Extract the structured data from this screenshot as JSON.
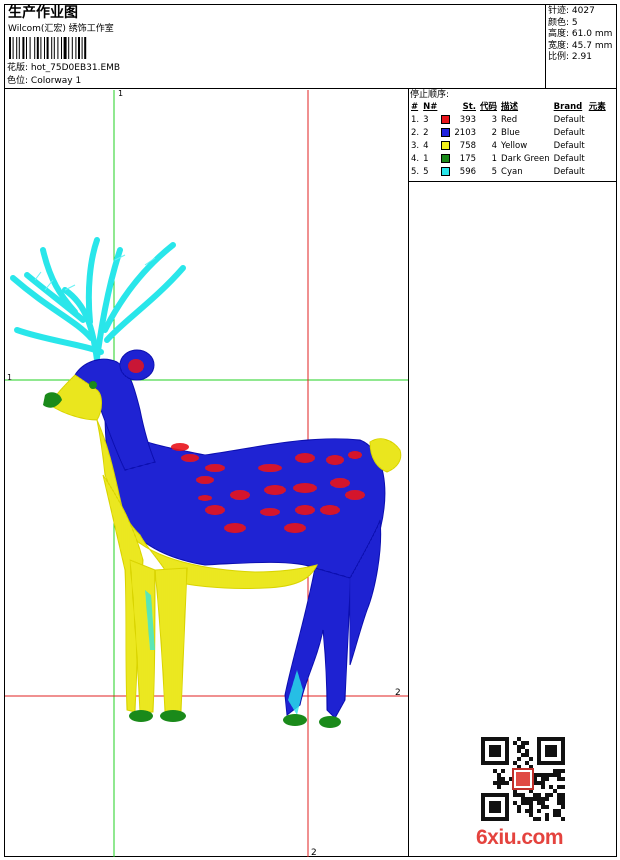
{
  "header": {
    "title": "生产作业图",
    "studio": "Wilcom(汇宏) 绣饰工作室",
    "design_label": "花版:",
    "design_file": "hot_75D0EB31.EMB",
    "colorway_label": "色位:",
    "colorway": "Colorway 1"
  },
  "stats": {
    "stitches_label": "针迹:",
    "stitches": "4027",
    "colors_label": "颜色:",
    "colors": "5",
    "height_label": "高度:",
    "height": "61.0 mm",
    "width_label": "宽度:",
    "width": "45.7 mm",
    "scale_label": "比例:",
    "scale": "2.91"
  },
  "sequence": {
    "heading": "停止顺序:",
    "columns": [
      "#",
      "N#",
      "St.",
      "代码",
      "描述",
      "Brand",
      "元素"
    ],
    "rows": [
      {
        "idx": "1.",
        "n": "3",
        "color": "#e8141b",
        "st": "393",
        "code": "3",
        "desc": "Red",
        "brand": "Default"
      },
      {
        "idx": "2.",
        "n": "2",
        "color": "#1f22e0",
        "st": "2103",
        "code": "2",
        "desc": "Blue",
        "brand": "Default"
      },
      {
        "idx": "3.",
        "n": "4",
        "color": "#f2ef1a",
        "st": "758",
        "code": "4",
        "desc": "Yellow",
        "brand": "Default"
      },
      {
        "idx": "4.",
        "n": "1",
        "color": "#1a8a1a",
        "st": "175",
        "code": "1",
        "desc": "Dark Green",
        "brand": "Default"
      },
      {
        "idx": "5.",
        "n": "5",
        "color": "#29e6ea",
        "st": "596",
        "code": "5",
        "desc": "Cyan",
        "brand": "Default"
      }
    ]
  },
  "guides": {
    "green_label": "1",
    "red_label": "2"
  },
  "watermark": {
    "site": "6xiu.com"
  },
  "colors": {
    "guide_green": "#20d020",
    "guide_red": "#e02020"
  }
}
